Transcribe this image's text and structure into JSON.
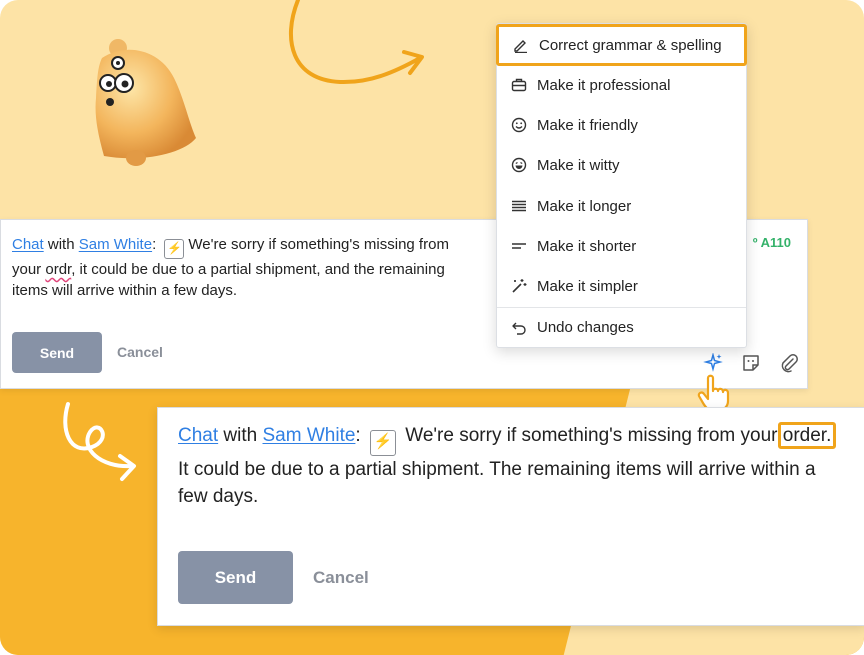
{
  "menu": {
    "items": [
      {
        "label": "Correct grammar & spelling",
        "icon": "pencil-icon",
        "active": true
      },
      {
        "label": "Make it professional",
        "icon": "briefcase-icon"
      },
      {
        "label": "Make it friendly",
        "icon": "smile-icon"
      },
      {
        "label": "Make it witty",
        "icon": "laugh-icon"
      },
      {
        "label": "Make it longer",
        "icon": "lines-long-icon"
      },
      {
        "label": "Make it shorter",
        "icon": "lines-short-icon"
      },
      {
        "label": "Make it simpler",
        "icon": "magic-wand-icon"
      },
      {
        "label": "Undo changes",
        "icon": "undo-icon"
      }
    ]
  },
  "composer_before": {
    "chat_label": "Chat",
    "with_label": "with",
    "contact": "Sam White",
    "colon": ":",
    "text_1": "We're sorry if something's missing from your",
    "misspelled": "ordr",
    "text_2": ", it could be due to a partial shipment, and the remaining items will arrive within a few days.",
    "ticket": "º A110",
    "send_label": "Send",
    "cancel_label": "Cancel",
    "tool_icons": [
      "sparkles-icon",
      "sticker-icon",
      "paperclip-icon"
    ]
  },
  "composer_after": {
    "chat_label": "Chat",
    "with_label": "with",
    "contact": "Sam White",
    "colon": ":",
    "text_1": "We're sorry if something's missing from your",
    "corrected": "order.",
    "text_2": "It could be due to a partial shipment. The remaining items will arrive within a few days.",
    "send_label": "Send",
    "cancel_label": "Cancel"
  },
  "colors": {
    "accent_orange": "#f0a41b",
    "link_blue": "#2f7fe3",
    "send_button": "#8792a6",
    "ticket_green": "#34b26a",
    "bg_light": "#fde3a6",
    "bg_dark": "#f7b42c"
  }
}
